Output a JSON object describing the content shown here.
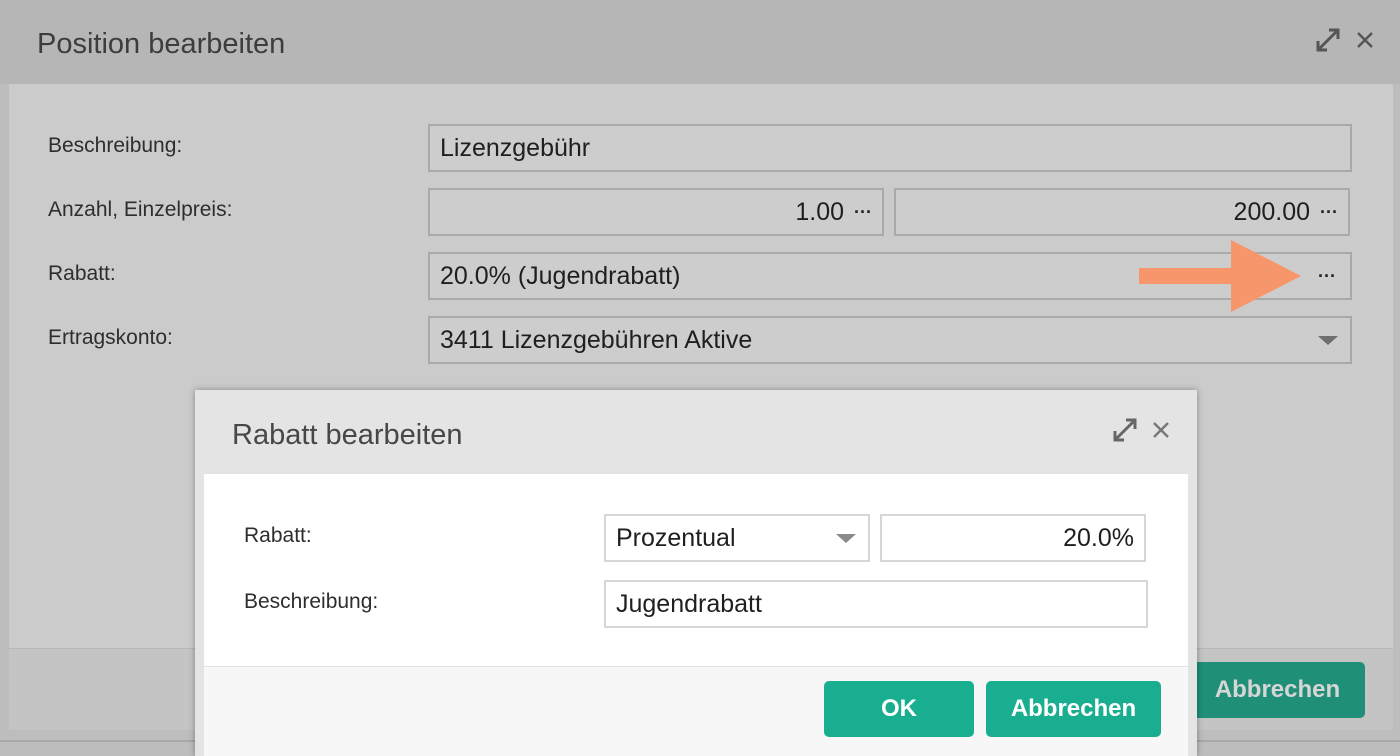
{
  "outer": {
    "title": "Position bearbeiten",
    "fields": {
      "beschreibung_label": "Beschreibung:",
      "beschreibung_value": "Lizenzgebühr",
      "anzahl_label": "Anzahl, Einzelpreis:",
      "anzahl_value": "1.00",
      "einzelpreis_value": "200.00",
      "rabatt_label": "Rabatt:",
      "rabatt_value": "20.0% (Jugendrabatt)",
      "ertragskonto_label": "Ertragskonto:",
      "ertragskonto_value": "3411 Lizenzgebühren Aktive"
    },
    "more_glyph": "···",
    "cancel_label": "Abbrechen"
  },
  "inner": {
    "title": "Rabatt bearbeiten",
    "rabatt_label": "Rabatt:",
    "rabatt_type_value": "Prozentual",
    "rabatt_amount_value": "20.0%",
    "beschreibung_label": "Beschreibung:",
    "beschreibung_value": "Jugendrabatt",
    "ok_label": "OK",
    "cancel_label": "Abbrechen"
  },
  "colors": {
    "accent": "#1aae91",
    "arrow": "#f7956b"
  },
  "icons": {
    "expand": "expand-icon",
    "close": "close-icon",
    "more": "more-icon",
    "dropdown": "chevron-down-icon"
  }
}
